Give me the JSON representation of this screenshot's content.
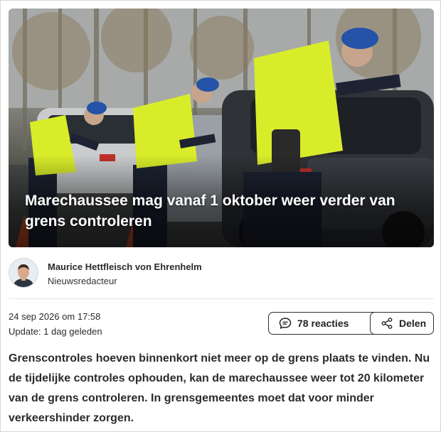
{
  "article": {
    "image_alt": "Marechaussee controleert auto's bij de grens",
    "headline": "Marechaussee mag vanaf 1 oktober weer verder van grens controleren",
    "author": {
      "name": "Maurice Hettfleisch von Ehrenhelm",
      "role": "Nieuwsredacteur",
      "avatar_icon": "person-avatar"
    },
    "date": "24 sep 2026 om 17:58",
    "updated": "Update: 1 dag geleden",
    "actions": {
      "comments_label": "78 reacties",
      "comments_icon": "speech-bubble-icon",
      "share_label": "Delen",
      "share_icon": "share-nodes-icon"
    },
    "intro": "Grenscontroles hoeven binnenkort niet meer op de grens plaats te vinden. Nu de tijdelijke controles ophouden, kan de marechaussee weer tot 20 kilometer van de grens controleren. In grensgemeentes moet dat voor minder verkeershinder zorgen."
  },
  "colors": {
    "headline_text": "#ffffff",
    "body_text": "#2b2b2b",
    "vest": "#d9ec2a",
    "beret": "#2453a8",
    "button_border": "#2e2e2e"
  }
}
